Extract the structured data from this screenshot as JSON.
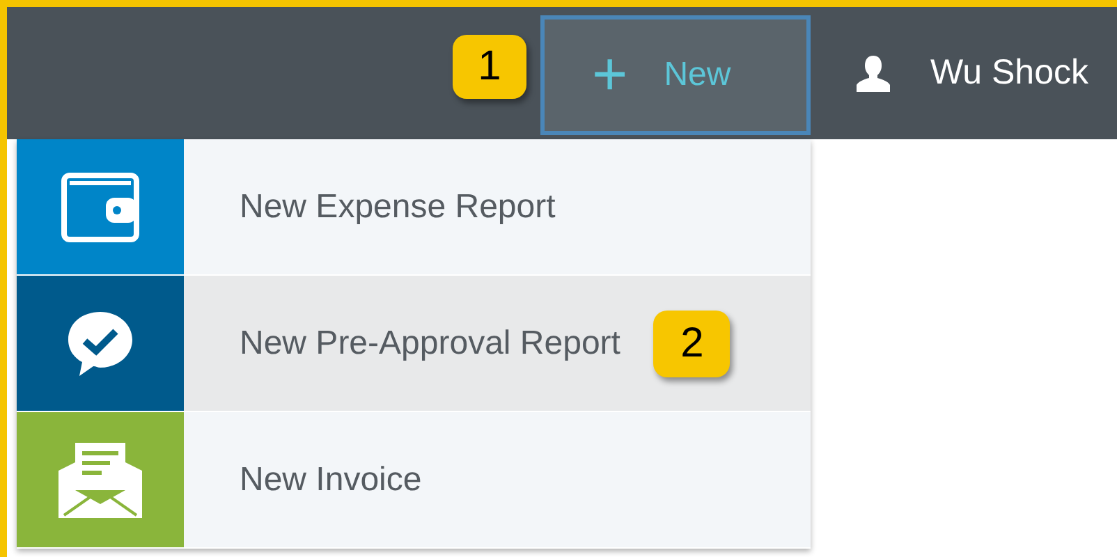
{
  "top_bar": {
    "callout": "1",
    "new_button": {
      "icon_text": "+",
      "label": "New"
    },
    "user_name": "Wu Shock"
  },
  "menu": {
    "items": [
      {
        "label": "New Expense Report",
        "kind": "wallet",
        "color": "#0085c8",
        "selected": false
      },
      {
        "label": "New Pre-Approval Report",
        "kind": "approval",
        "color": "#005a8c",
        "selected": true,
        "callout": "2"
      },
      {
        "label": "New Invoice",
        "kind": "invoice",
        "color": "#8ab53b",
        "selected": false
      }
    ]
  }
}
